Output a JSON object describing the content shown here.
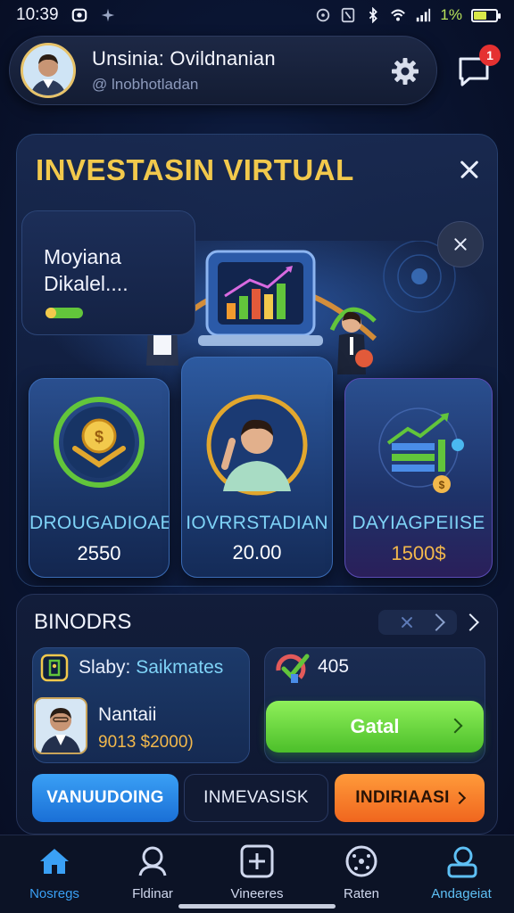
{
  "status_bar": {
    "time": "10:39",
    "battery_text": "1%",
    "battery_level": 0.55,
    "icons": [
      "alarm-icon",
      "airplane-icon",
      "vibrate-icon",
      "nfc-icon",
      "bluetooth-icon",
      "wifi-icon",
      "signal-icon",
      "battery-icon"
    ]
  },
  "header": {
    "user_name": "Unsinia: Ovildnanian",
    "user_handle": "@ lnobhotladan",
    "notification_count": "1"
  },
  "main": {
    "title": "INVESTASIN VIRTUAL",
    "info_title_line1": "Moyiana",
    "info_title_line2": "Dikalel....",
    "cards": [
      {
        "label": "DROUGADIOAE",
        "value": "2550"
      },
      {
        "label": "IOVRRSTADIAN",
        "value": "20.00"
      },
      {
        "label": "DAYIAGPEIISE",
        "value": "1500$"
      }
    ]
  },
  "bottom": {
    "section_title": "BINODRS",
    "row_label": "Slaby:",
    "row_accent": "Saikmates",
    "person_name": "Nantaii",
    "person_amount": "9013 $2000)",
    "stat_value": "405",
    "go_label": "Gatal",
    "buttons": [
      "VANUUDOING",
      "INMEVASISK",
      "INDIRIAASI"
    ]
  },
  "nav": {
    "items": [
      {
        "label": "Nosregs",
        "icon": "home-icon"
      },
      {
        "label": "Fldinar",
        "icon": "user-icon"
      },
      {
        "label": "Vineeres",
        "icon": "plus-square-icon"
      },
      {
        "label": "Raten",
        "icon": "network-icon"
      },
      {
        "label": "Andageiat",
        "icon": "profile-icon"
      }
    ]
  },
  "colors": {
    "accent_gold": "#f2c94c",
    "accent_blue": "#3aa0f5",
    "accent_green": "#62c53b",
    "accent_orange": "#f0661e",
    "badge_red": "#e53131"
  }
}
